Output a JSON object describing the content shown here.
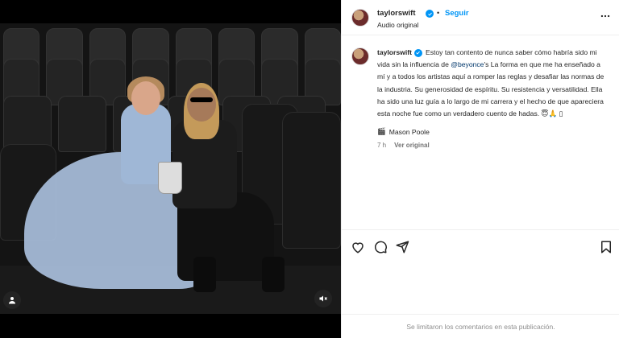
{
  "post": {
    "username": "taylorswift",
    "follow_label": "Seguir",
    "separator": "•",
    "audio_label": "Audio original",
    "caption_user": "taylorswift",
    "caption_part1": "Estoy tan contento de nunca saber cómo habría sido mi vida sin la influencia de ",
    "caption_mention": "@beyonce",
    "caption_part2": "'s La forma en que me ha enseñado a mí y a todos los artistas aquí a romper las reglas y desafiar las normas de la industria. Su generosidad de espíritu. Su resistencia y versatilidad. Ella ha sido una luz guía a lo largo de mi carrera y el hecho de que apareciera esta noche fue como un verdadero cuento de hadas. 😇🙏 ▯",
    "credit_emoji": "🎬",
    "credit_name": "Mason Poole",
    "time": "7 h",
    "see_original": "Ver original",
    "comments_disabled": "Se limitaron los comentarios en esta publicación."
  },
  "icons": {
    "verified": "verified-badge",
    "more": "more-options-icon",
    "like": "heart-icon",
    "comment": "comment-icon",
    "share": "send-icon",
    "save": "bookmark-icon",
    "tag": "user-tag-icon",
    "mute": "mute-icon"
  },
  "colors": {
    "accent": "#0095f6",
    "mention": "#00376b",
    "muted": "#737373"
  }
}
